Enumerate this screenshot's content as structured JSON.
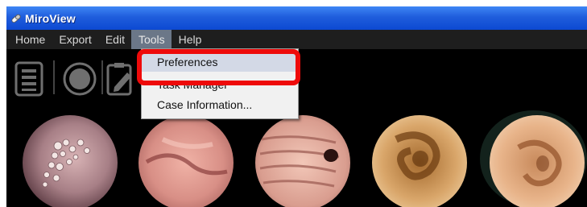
{
  "app": {
    "title": "MiroView",
    "title_icon": "pill-icon"
  },
  "menubar": {
    "items": [
      {
        "label": "Home"
      },
      {
        "label": "Export"
      },
      {
        "label": "Edit"
      },
      {
        "label": "Tools"
      },
      {
        "label": "Help"
      }
    ],
    "open_menu": "Tools"
  },
  "toolbar": {
    "buttons": [
      {
        "icon": "list-icon"
      },
      {
        "icon": "record-icon"
      },
      {
        "icon": "clipboard-edit-icon"
      }
    ]
  },
  "tools_menu": {
    "items": [
      {
        "label": "Preferences"
      },
      {
        "label": "Task Manager"
      },
      {
        "label": "Case Information..."
      }
    ],
    "highlighted": "Preferences"
  },
  "thumbnails": {
    "count": 5,
    "selected_index": 4
  },
  "colors": {
    "titlebar": "#1f5ddc",
    "callout": "#ee0a0a",
    "menu_open": "#6b7788"
  }
}
